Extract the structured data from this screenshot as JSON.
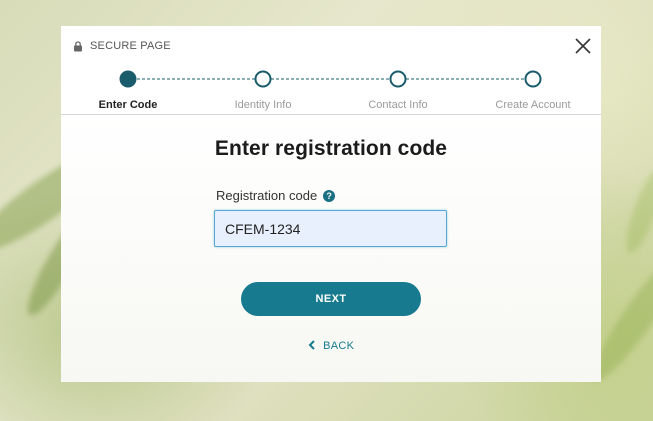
{
  "header": {
    "secure_label": "SECURE PAGE"
  },
  "stepper": {
    "steps": [
      {
        "label": "Enter Code",
        "state": "current"
      },
      {
        "label": "Identity Info",
        "state": "upcoming"
      },
      {
        "label": "Contact Info",
        "state": "upcoming"
      },
      {
        "label": "Create Account",
        "state": "upcoming"
      }
    ]
  },
  "form": {
    "title": "Enter registration code",
    "field_label": "Registration code",
    "help_glyph": "?",
    "code_value": "CFEM-1234",
    "next_label": "NEXT",
    "back_label": "BACK"
  },
  "colors": {
    "accent": "#177a8e",
    "step_complete": "#1a5c6b",
    "input_bg": "#e8f0fd",
    "input_border": "#57a7d3"
  },
  "icons": [
    "lock-icon",
    "close-icon",
    "help-icon",
    "chevron-left-icon"
  ]
}
